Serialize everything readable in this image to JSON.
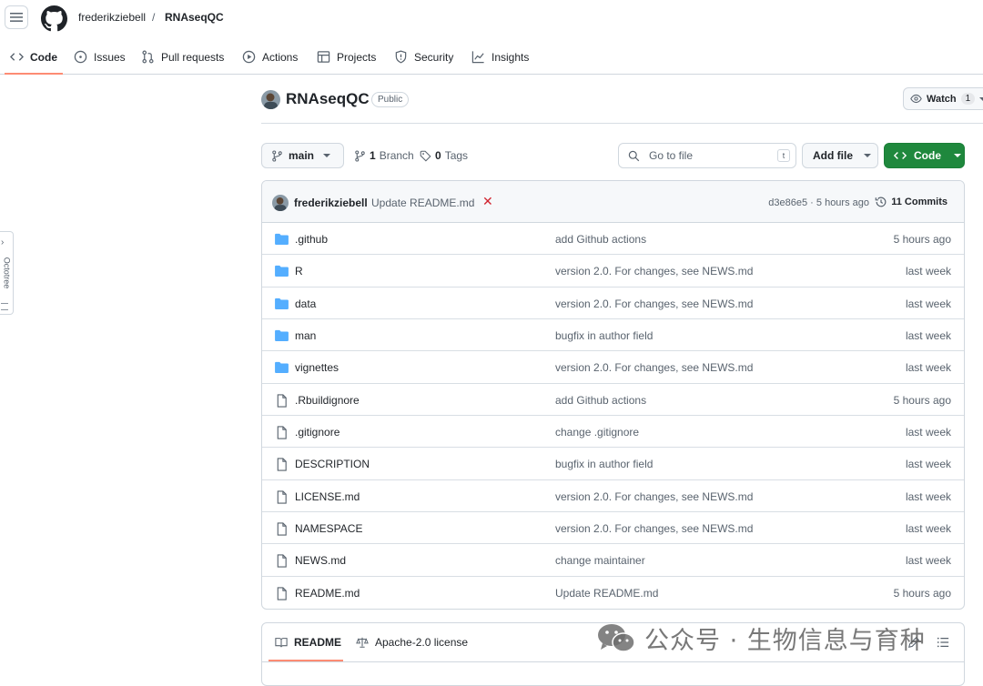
{
  "header": {
    "owner": "frederikziebell",
    "separator": "/",
    "repo": "RNAseqQC"
  },
  "tabs": [
    {
      "label": "Code",
      "icon": "code-icon",
      "active": true
    },
    {
      "label": "Issues",
      "icon": "issue-opened-icon"
    },
    {
      "label": "Pull requests",
      "icon": "git-pull-request-icon"
    },
    {
      "label": "Actions",
      "icon": "play-icon"
    },
    {
      "label": "Projects",
      "icon": "table-icon"
    },
    {
      "label": "Security",
      "icon": "shield-icon"
    },
    {
      "label": "Insights",
      "icon": "graph-icon"
    }
  ],
  "octotree": {
    "label": "Octotree"
  },
  "repo": {
    "name": "RNAseqQC",
    "visibility": "Public",
    "watch_label": "Watch",
    "watch_count": "1"
  },
  "toolbar": {
    "branch": "main",
    "branches_count": "1",
    "branches_label": "Branch",
    "tags_count": "0",
    "tags_label": "Tags",
    "search_placeholder": "Go to file",
    "search_shortcut": "t",
    "add_file": "Add file",
    "code": "Code"
  },
  "commit": {
    "author": "frederikziebell",
    "message": "Update README.md",
    "status": "failed",
    "hash_time": "d3e86e5 · 5 hours ago",
    "commits_label": "11 Commits"
  },
  "files": [
    {
      "name": ".github",
      "type": "dir",
      "message": "add Github actions",
      "age": "5 hours ago"
    },
    {
      "name": "R",
      "type": "dir",
      "message": "version 2.0. For changes, see NEWS.md",
      "age": "last week"
    },
    {
      "name": "data",
      "type": "dir",
      "message": "version 2.0. For changes, see NEWS.md",
      "age": "last week"
    },
    {
      "name": "man",
      "type": "dir",
      "message": "bugfix in author field",
      "age": "last week"
    },
    {
      "name": "vignettes",
      "type": "dir",
      "message": "version 2.0. For changes, see NEWS.md",
      "age": "last week"
    },
    {
      "name": ".Rbuildignore",
      "type": "file",
      "message": "add Github actions",
      "age": "5 hours ago"
    },
    {
      "name": ".gitignore",
      "type": "file",
      "message": "change .gitignore",
      "age": "last week"
    },
    {
      "name": "DESCRIPTION",
      "type": "file",
      "message": "bugfix in author field",
      "age": "last week"
    },
    {
      "name": "LICENSE.md",
      "type": "file",
      "message": "version 2.0. For changes, see NEWS.md",
      "age": "last week"
    },
    {
      "name": "NAMESPACE",
      "type": "file",
      "message": "version 2.0. For changes, see NEWS.md",
      "age": "last week"
    },
    {
      "name": "NEWS.md",
      "type": "file",
      "message": "change maintainer",
      "age": "last week"
    },
    {
      "name": "README.md",
      "type": "file",
      "message": "Update README.md",
      "age": "5 hours ago"
    }
  ],
  "readme_tabs": [
    {
      "label": "README",
      "icon": "book-icon",
      "active": true
    },
    {
      "label": "Apache-2.0 license",
      "icon": "law-icon"
    }
  ],
  "watermark": {
    "text": "公众号 · 生物信息与育种"
  },
  "colors": {
    "accent_underline": "#fd8c73",
    "code_button": "#1f883d",
    "folder": "#54aeff",
    "fail": "#d1242f"
  }
}
